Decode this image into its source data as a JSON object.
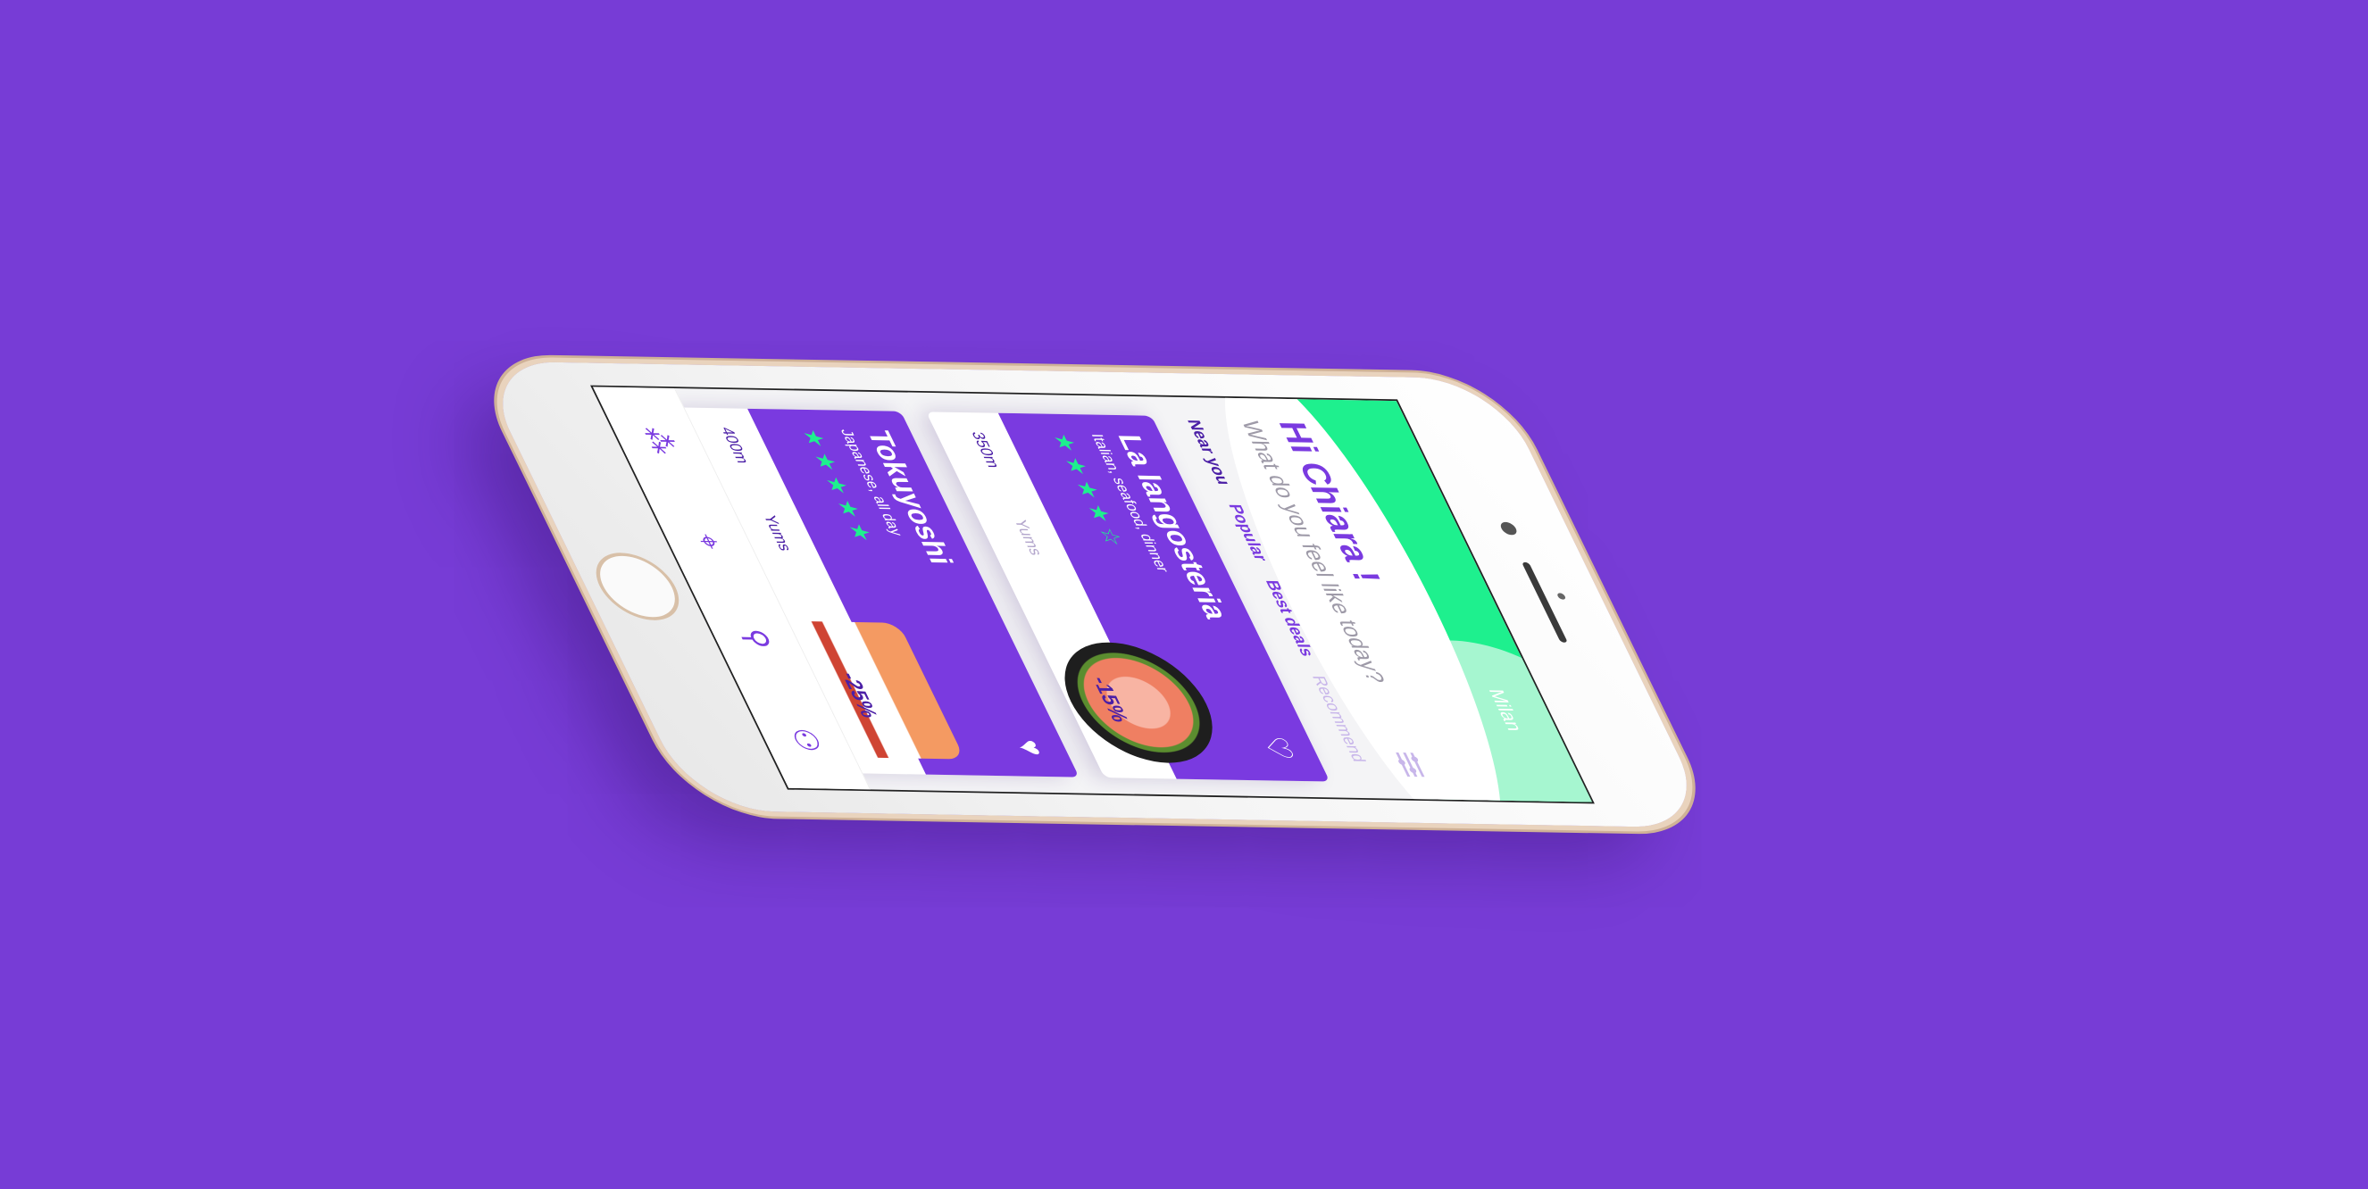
{
  "app": {
    "city": "Milan",
    "greeting": "Hi Chiara !",
    "question": "What do you feel like today?",
    "tabs": [
      {
        "label": "Near you",
        "active": true
      },
      {
        "label": "Popular",
        "active": false
      },
      {
        "label": "Best deals",
        "active": false
      },
      {
        "label": "Recommend",
        "active": false
      }
    ],
    "cards": [
      {
        "name": "La langosteria",
        "subtitle": "Italian, seafood, dinner",
        "rating": 4,
        "stars": "★★★★☆",
        "distance": "350m",
        "yums": "Yums",
        "discount": "-15%",
        "favorited": false,
        "heart": "♡",
        "dish_icon": "shrimp-dish-image"
      },
      {
        "name": "Tokuyoshi",
        "subtitle": "Japanese, all day",
        "rating": 5,
        "stars": "★★★★★",
        "distance": "400m",
        "yums": "Yums",
        "discount": "-25%",
        "favorited": true,
        "heart": "♥",
        "dish_icon": "sushi-dish-image"
      }
    ],
    "tabbar": {
      "home_icon": "⁂",
      "map_icon": "⌖",
      "search_icon": "⚲",
      "profile_icon": "⚇"
    }
  },
  "colors": {
    "background": "#773cd6",
    "brand_purple": "#7a3ae0",
    "accent_green": "#1ef08e"
  }
}
